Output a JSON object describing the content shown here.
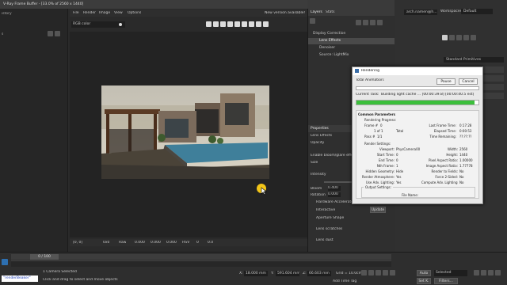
{
  "vfb": {
    "title": "V-Ray Frame Buffer - [33.0% of 2560 x 1440]",
    "menu": [
      "File",
      "Render",
      "Image",
      "View",
      "Options"
    ],
    "notice": "New version available!",
    "channel": "RGB color",
    "left_tab": "istory",
    "left_sub": "s",
    "layers_tabs": [
      "Layers",
      "Stats"
    ],
    "layers": [
      "Display Correction",
      "Lens Effects",
      "Denoiser",
      "Source: LightMix"
    ],
    "properties_title": "Properties",
    "props": {
      "lens_effects": "Lens Effects",
      "opacity": "Opacity",
      "enable_bloom": "Enable bloom/glare effect",
      "size": "Size",
      "intensity": "Intensity",
      "bloom": "Bloom",
      "bloom_val": "0.400",
      "rotation": "Rotation",
      "rotation_val": "0.000",
      "hw_accel": "Hardware Accelerated",
      "interactive": "Interactive",
      "update": "Update",
      "aperture": "Aperture Shape",
      "lens_scratches": "Lens scratches",
      "lens_dust": "Lens dust"
    },
    "status_coords": "[0, 0]",
    "status_vals": [
      "0x0",
      "Raw",
      "0.000",
      "0.000",
      "0.000",
      "HSV",
      "0",
      "0.0"
    ]
  },
  "max": {
    "user": "arch.namen@h...",
    "workspaces_label": "Workspaces:",
    "workspace": "Default",
    "panel_label": "Standard Primitives",
    "timeline": "0 / 100",
    "status_selected": "1 Camera Selected",
    "status_hint": "Click and drag to select and move objects",
    "maxscript": "\"renderBeaker\"",
    "x_label": "X:",
    "x_val": "18.000 mm",
    "y_label": "Y:",
    "y_val": "591.604 mm",
    "z_label": "Z:",
    "z_val": "66.603 mm",
    "grid": "Grid = 10.0cm",
    "add_time_tag": "Add Time Tag",
    "auto": "Auto",
    "selected": "Selected",
    "set_k": "Set K.",
    "filters": "Filters..."
  },
  "rendering": {
    "title": "Rendering",
    "pause": "Pause",
    "cancel": "Cancel",
    "total_animation": "Total Animation:",
    "current_task_label": "Current Task:",
    "current_task": "Building light cache ... [00:00:39.8] [00:00:40.5 est]",
    "progress": 0.97,
    "section_common": "Common Parameters",
    "rendering_progress": "Rendering Progress:",
    "frame_label": "Frame #",
    "frame_val": "0",
    "of_label": "1 of 1",
    "total_label": "Total",
    "pass_label": "Pass #",
    "pass_val": "1/1",
    "last_frame_time_label": "Last Frame Time:",
    "last_frame_time": "0:17:28",
    "elapsed_time_label": "Elapsed Time:",
    "elapsed_time": "0:00:53",
    "time_remaining_label": "Time Remaining:",
    "time_remaining": "??:??:??",
    "render_settings": "Render Settings:",
    "left_keys": [
      "Viewport:",
      "Start Time:",
      "End Time:",
      "Nth Frame:",
      "Hidden Geometry:",
      "Render Atmosphere:",
      "Use Adv. Lighting:"
    ],
    "left_vals": [
      "PhysCamera009",
      "0",
      "0",
      "1",
      "Hide",
      "Yes",
      "Yes"
    ],
    "right_keys": [
      "Width:",
      "Height:",
      "Pixel Aspect Ratio:",
      "Image Aspect Ratio:",
      "Render to Fields:",
      "Force 2-Sided:",
      "Compute Adv. Lighting:"
    ],
    "right_vals": [
      "2560",
      "1440",
      "1.00000",
      "1.77778",
      "No",
      "No",
      "No"
    ],
    "output_settings": "Output Settings:",
    "file_name": "File Name:"
  },
  "colors": {
    "accent_green": "#3cbf3c",
    "sky": "#c9c4b5",
    "pool": "#3f7f9a"
  }
}
